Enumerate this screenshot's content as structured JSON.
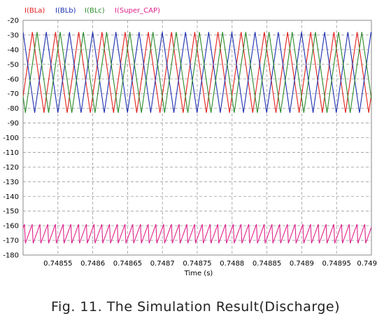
{
  "caption": "Fig. 11. The Simulation Result(Discharge)",
  "chart_data": {
    "type": "line",
    "xlabel": "Time (s)",
    "ylabel": "",
    "xlim": [
      0.7485,
      0.749
    ],
    "ylim": [
      -180,
      -20
    ],
    "x_ticks": [
      0.74855,
      0.7486,
      0.74865,
      0.7487,
      0.74875,
      0.7488,
      0.74885,
      0.7489,
      0.74895,
      0.749
    ],
    "x_tick_labels": [
      "0.74855",
      "0.7486",
      "0.74865",
      "0.7487",
      "0.74875",
      "0.7488",
      "0.74885",
      "0.7489",
      "0.74895",
      "0.749"
    ],
    "y_ticks": [
      -20,
      -30,
      -40,
      -50,
      -60,
      -70,
      -80,
      -90,
      -100,
      -110,
      -120,
      -130,
      -140,
      -150,
      -160,
      -170,
      -180
    ],
    "y_tick_labels": [
      "-20",
      "-30",
      "-40",
      "-50",
      "-60",
      "-70",
      "-80",
      "-90",
      "-100",
      "-110",
      "-120",
      "-130",
      "-140",
      "-150",
      "-160",
      "-170",
      "-180"
    ],
    "grid": true,
    "legend_position": "top-left",
    "series": [
      {
        "name": "I(BLa)",
        "color": "#e0201c",
        "shape": "triangle",
        "period": 3.33e-05,
        "peak_times": [
          0.74848,
          0.74851333,
          0.74854667,
          0.74858,
          0.74861333,
          0.74864667,
          0.74868,
          0.74871333,
          0.74874667,
          0.74878,
          0.74881333,
          0.74884667,
          0.74888,
          0.74891333,
          0.74894667,
          0.74898
        ],
        "max": -28,
        "min": -83
      },
      {
        "name": "I(BLb)",
        "color": "#1c2fb0",
        "shape": "triangle",
        "period": 3.33e-05,
        "peak_times": [
          0.7485,
          0.74853333,
          0.74856667,
          0.7486,
          0.74863333,
          0.74866667,
          0.7487,
          0.74873333,
          0.74876667,
          0.7488,
          0.74883333,
          0.74886667,
          0.7489,
          0.74893333,
          0.74896667,
          0.749
        ],
        "max": -28,
        "min": -83
      },
      {
        "name": "I(BLc)",
        "color": "#2a8a2a",
        "shape": "triangle",
        "period": 3.33e-05,
        "peak_times": [
          0.74852,
          0.74855333,
          0.74858667,
          0.74862,
          0.74865333,
          0.74868667,
          0.74872,
          0.74875333,
          0.74878667,
          0.74882,
          0.74885333,
          0.74888667,
          0.74892,
          0.74895333,
          0.74898667
        ],
        "max": -28,
        "min": -83
      },
      {
        "name": "I(Super_CAP)",
        "color": "#e0208a",
        "shape": "sawtooth",
        "period": 1.11e-05,
        "drop_times_start": 0.748502,
        "max": -159,
        "min": -172
      }
    ]
  }
}
